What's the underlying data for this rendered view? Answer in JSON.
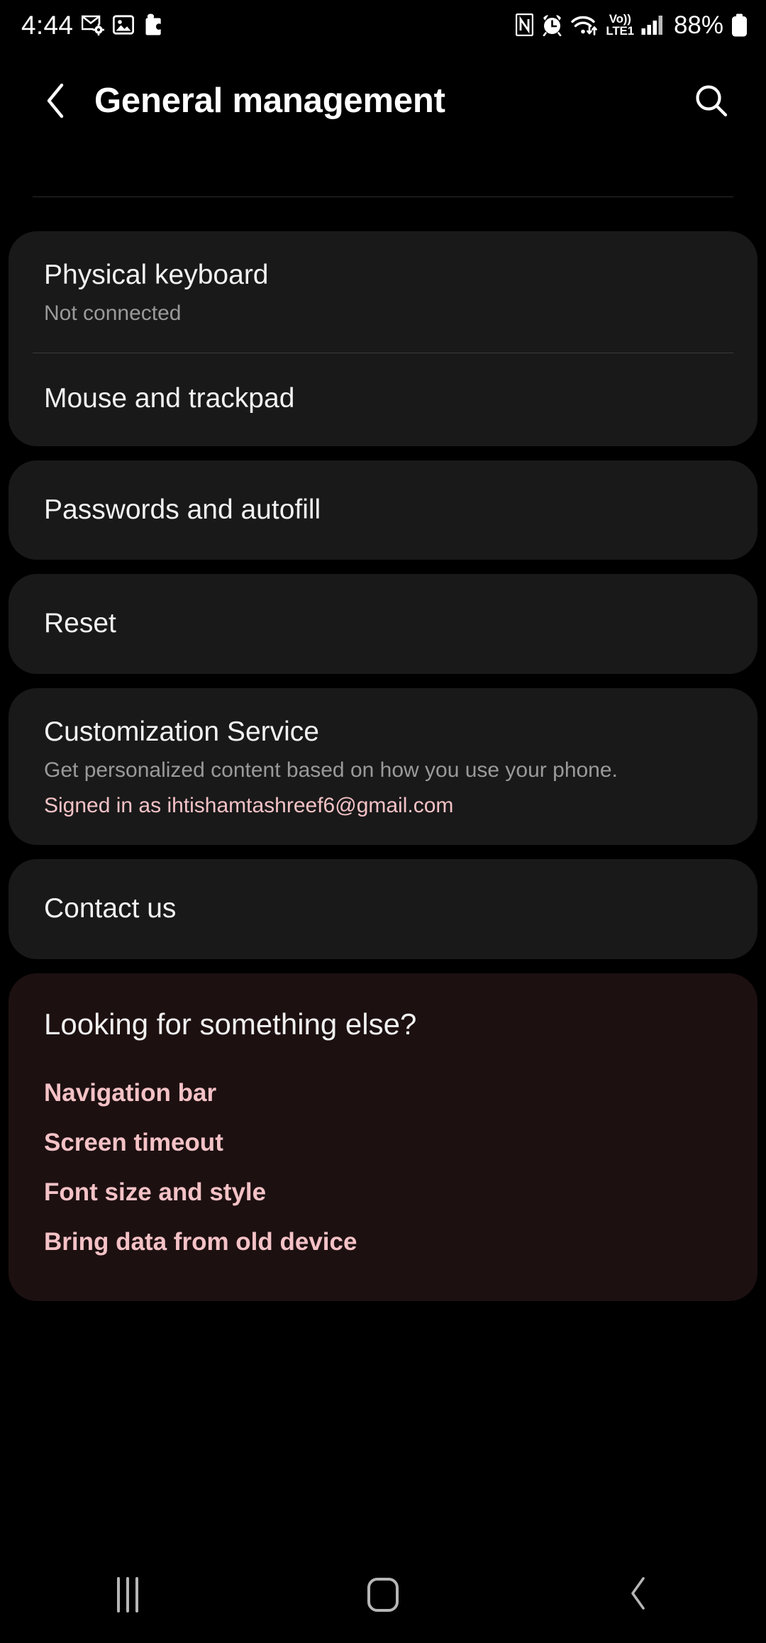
{
  "status_bar": {
    "time": "4:44",
    "left_icons": [
      "mail-settings-icon",
      "image-icon",
      "puzzle-piece-icon"
    ],
    "right_icons": [
      "nfc-icon",
      "alarm-icon",
      "wifi-icon",
      "signal-icon"
    ],
    "volte_line1": "Vo))",
    "volte_line2": "LTE1",
    "battery_percent": "88%"
  },
  "app_bar": {
    "title": "General management",
    "back_icon": "back-chevron-icon",
    "search_icon": "search-icon"
  },
  "cards": {
    "input": [
      {
        "title": "Physical keyboard",
        "sub": "Not connected"
      },
      {
        "title": "Mouse and trackpad"
      }
    ],
    "passwords": {
      "title": "Passwords and autofill"
    },
    "reset": {
      "title": "Reset"
    },
    "customization": {
      "title": "Customization Service",
      "sub": "Get personalized content based on how you use your phone.",
      "account": "Signed in as ihtishamtashreef6@gmail.com"
    },
    "contact": {
      "title": "Contact us"
    },
    "looking_for": {
      "heading": "Looking for something else?",
      "links": [
        "Navigation bar",
        "Screen timeout",
        "Font size and style",
        "Bring data from old device"
      ]
    }
  },
  "nav_bar": {
    "recents_label": "recents-icon",
    "home_label": "home-icon",
    "back_label": "back-icon"
  },
  "colors": {
    "background": "#000000",
    "card": "#191919",
    "card_tinted": "#1d1011",
    "accent_pink": "#f4c2c6",
    "text_primary": "#f2f2f2",
    "text_secondary": "#9a9a9a"
  }
}
